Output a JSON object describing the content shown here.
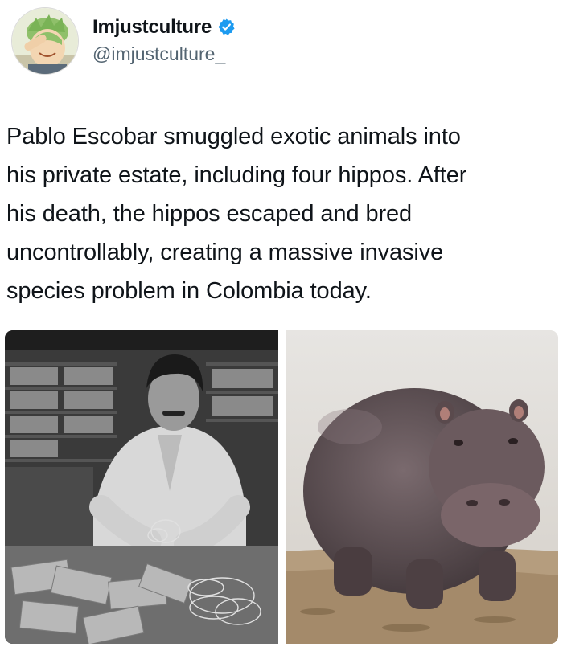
{
  "author": {
    "display_name": "Imjustculture",
    "handle": "@imjustculture_",
    "verified": true,
    "verified_color": "#1d9bf0",
    "avatar_icon": "avatar-anime-character"
  },
  "tweet": {
    "text_lines": [
      "Pablo Escobar smuggled exotic animals into",
      "his private estate, including four hippos. After",
      "his death, the hippos escaped and bred",
      "uncontrollably, creating a massive invasive",
      "species problem in Colombia today."
    ]
  },
  "media": [
    {
      "kind": "photo",
      "subject": "black-and-white-man-with-money"
    },
    {
      "kind": "photo",
      "subject": "hippopotamus-standing"
    }
  ],
  "colors": {
    "text": "#0f1419",
    "secondary_text": "#536471",
    "accent": "#1d9bf0"
  }
}
